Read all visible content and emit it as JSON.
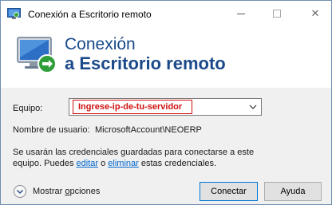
{
  "window": {
    "title": "Conexión a Escritorio remoto"
  },
  "titlebar": {
    "minimize_icon": "minimize-icon",
    "maximize_icon": "maximize-icon",
    "close_glyph": "✕"
  },
  "banner": {
    "line1": "Conexión",
    "line2": "a Escritorio remoto",
    "icon": "remote-desktop-icon"
  },
  "form": {
    "computer_label": "Equipo:",
    "computer_value": "Ingrese-ip-de-tu-servidor",
    "username_label": "Nombre de usuario:",
    "username_value": "MicrosoftAccount\\NEOERP",
    "info_prefix": "Se usarán las credenciales guardadas para conectarse a este equipo. Puedes ",
    "edit_link": "editar",
    "info_middle": " o ",
    "delete_link": "eliminar",
    "info_suffix": " estas credenciales."
  },
  "footer": {
    "options_prefix": "Mostrar ",
    "options_underlined": "o",
    "options_suffix": "pciones",
    "connect_label": "Conectar",
    "help_label": "Ayuda"
  },
  "colors": {
    "banner_text": "#1b4a8a",
    "highlight": "#d01010",
    "link": "#0066cc",
    "primary_border": "#0078d7"
  }
}
